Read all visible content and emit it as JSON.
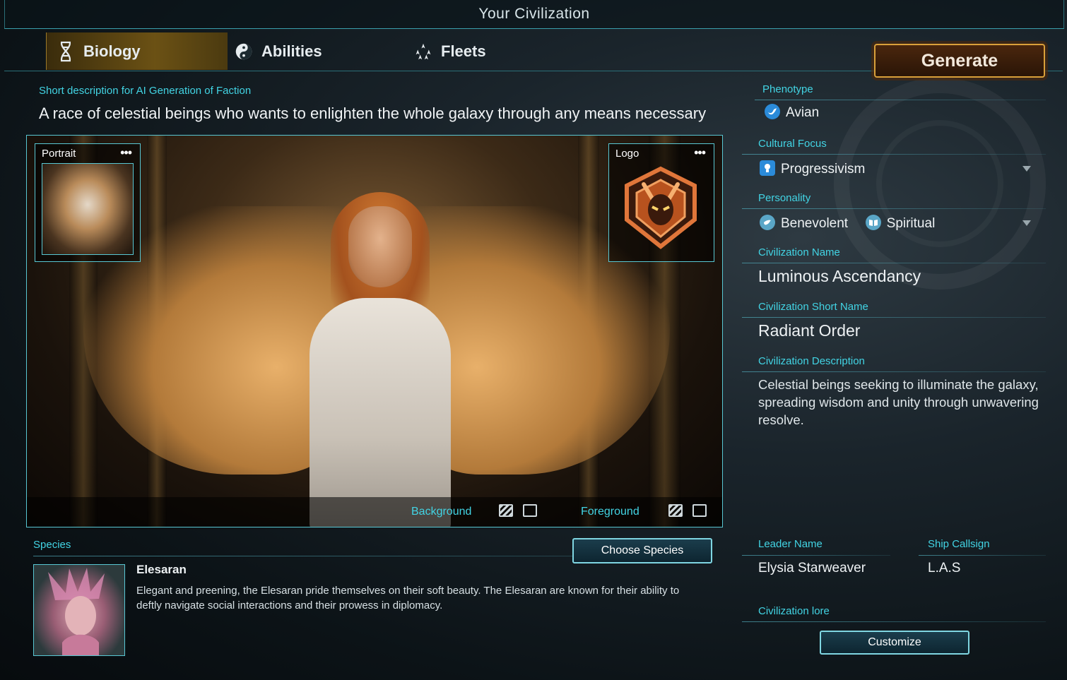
{
  "window": {
    "title": "Your Civilization"
  },
  "tabs": [
    {
      "label": "Biology",
      "icon": "dna-icon",
      "active": true
    },
    {
      "label": "Abilities",
      "icon": "yin-yang-icon",
      "active": false
    },
    {
      "label": "Fleets",
      "icon": "fleet-icon",
      "active": false
    }
  ],
  "generate_label": "Generate",
  "short_description": {
    "label": "Short description for AI Generation of Faction",
    "value": "A race of celestial beings who wants to enlighten the whole galaxy through any means necessary"
  },
  "image_panel": {
    "portrait_label": "Portrait",
    "logo_label": "Logo",
    "more_glyph": "•••",
    "background_label": "Background",
    "foreground_label": "Foreground"
  },
  "species": {
    "label": "Species",
    "choose_label": "Choose Species",
    "name": "Elesaran",
    "description": "Elegant and preening, the Elesaran pride themselves on their soft beauty. The Elesaran are known for their ability to deftly navigate social interactions and their prowess in diplomacy."
  },
  "right_panel": {
    "phenotype": {
      "label": "Phenotype",
      "value": "Avian",
      "icon": "bird-icon"
    },
    "cultural_focus": {
      "label": "Cultural Focus",
      "value": "Progressivism",
      "icon": "lightbulb-icon"
    },
    "personality": {
      "label": "Personality",
      "values": [
        "Benevolent",
        "Spiritual"
      ]
    },
    "civ_name": {
      "label": "Civilization Name",
      "value": "Luminous Ascendancy"
    },
    "civ_short": {
      "label": "Civilization Short Name",
      "value": "Radiant Order"
    },
    "civ_desc": {
      "label": "Civilization Description",
      "value": "Celestial beings seeking to illuminate the galaxy, spreading wisdom and unity through unwavering resolve."
    },
    "leader": {
      "label": "Leader Name",
      "value": "Elysia Starweaver"
    },
    "callsign": {
      "label": "Ship Callsign",
      "value": "L.A.S"
    },
    "lore": {
      "label": "Civilization lore"
    },
    "customize_label": "Customize"
  },
  "colors": {
    "accent": "#42d4e4",
    "generate_border": "#d9a03a",
    "active_tab": "#6b5114"
  }
}
